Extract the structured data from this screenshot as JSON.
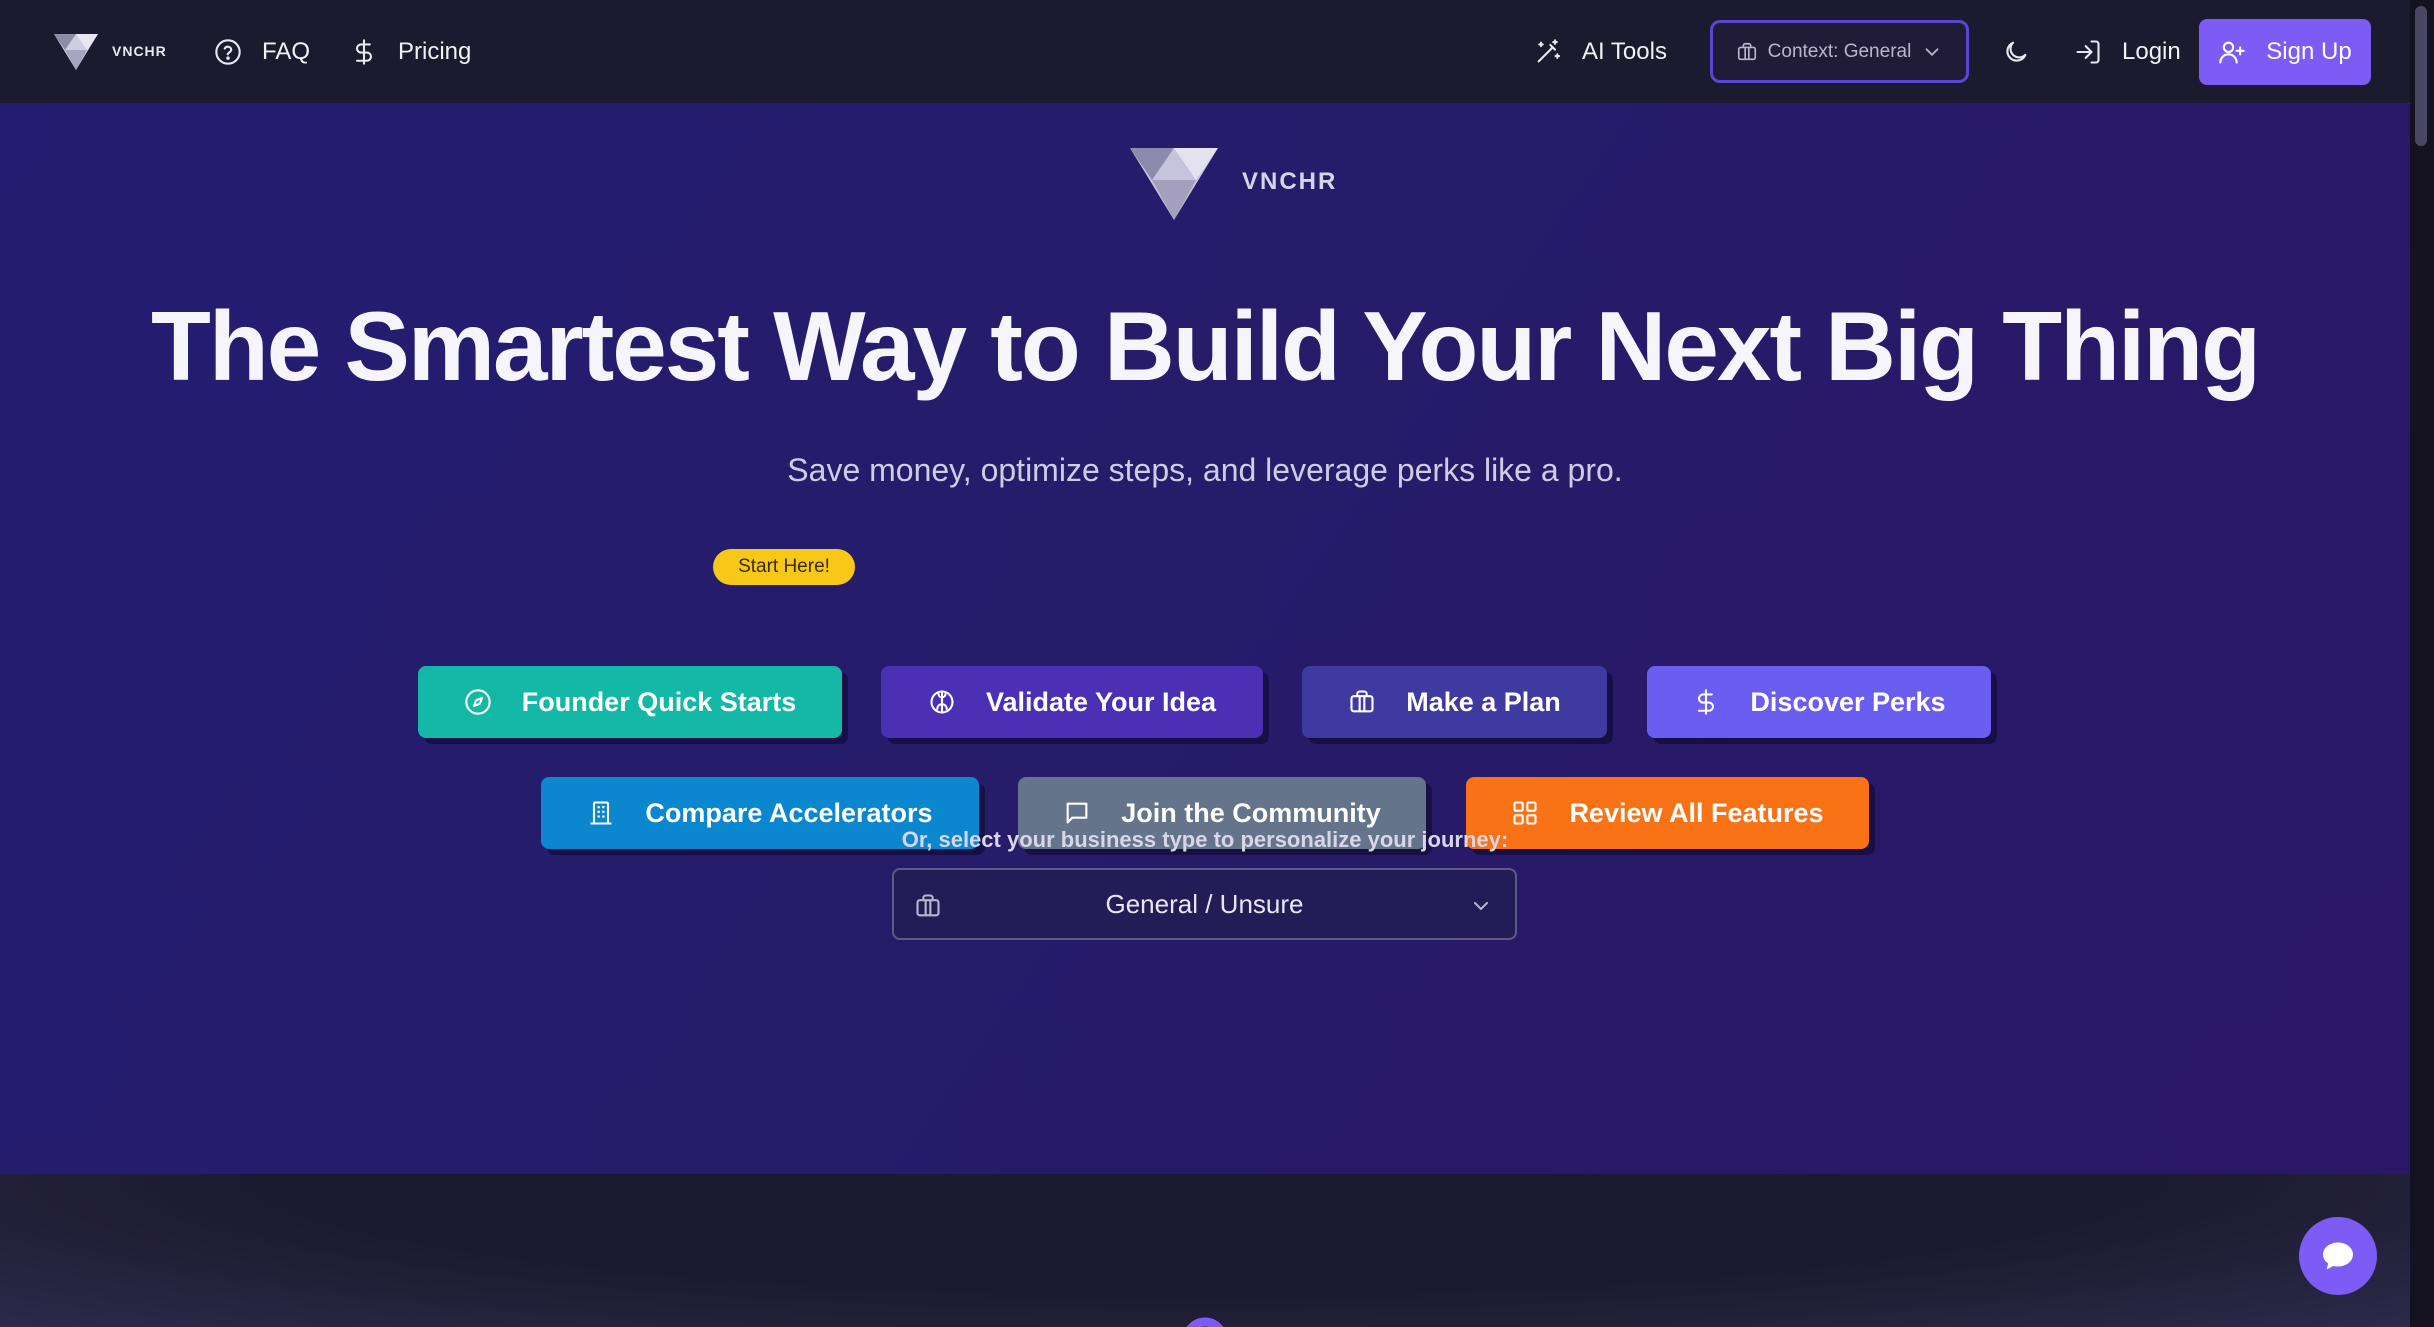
{
  "nav": {
    "brand": "VNCHR",
    "faq": "FAQ",
    "pricing": "Pricing",
    "ai_tools": "AI Tools",
    "context": "Context: General",
    "login": "Login",
    "signup": "Sign Up"
  },
  "hero": {
    "brand": "VNCHR",
    "headline": "The Smartest Way to Build Your Next Big Thing",
    "subhead": "Save money, optimize steps, and leverage perks like a pro.",
    "badge": "Start Here!",
    "buttons": [
      {
        "label": "Founder Quick Starts",
        "color": "#14b8a6"
      },
      {
        "label": "Validate Your Idea",
        "color": "#4b2fb4"
      },
      {
        "label": "Make a Plan",
        "color": "#3e3aa0"
      },
      {
        "label": "Discover Perks",
        "color": "#6a5ef0"
      },
      {
        "label": "Compare Accelerators",
        "color": "#0a87cf"
      },
      {
        "label": "Join the Community",
        "color": "#64748b"
      },
      {
        "label": "Review All Features",
        "color": "#f97316"
      }
    ],
    "select_label": "Or, select your business type to personalize your journey:",
    "select_value": "General / Unsure"
  },
  "colors": {
    "accent": "#7c5cf5",
    "badge": "#f7c818",
    "nav_bg": "#1c1a2e"
  }
}
